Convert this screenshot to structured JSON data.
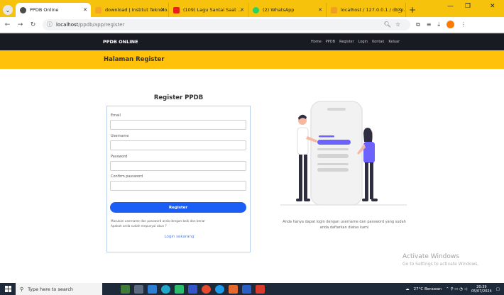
{
  "browser": {
    "tabs": [
      {
        "title": "PPDB Online",
        "favicon_color": "#4a4a4a",
        "active": true
      },
      {
        "title": "download | Institut Teknolo…",
        "favicon_color": "#f5a623",
        "active": false
      },
      {
        "title": "(109) Lagu Santai Saat …",
        "favicon_color": "#e62117",
        "active": false
      },
      {
        "title": "(2) WhatsApp",
        "favicon_color": "#25d366",
        "active": false
      },
      {
        "title": "localhost / 127.0.0.1 / db_p…",
        "favicon_color": "#f0a020",
        "active": false
      }
    ],
    "url_host": "localhost",
    "url_path": "/ppdb/app/register"
  },
  "site": {
    "brand": "PPDB ONLINE",
    "menu": [
      "Home",
      "PPDB",
      "Register",
      "Login",
      "Kontak",
      "Keluar"
    ],
    "page_title": "Halaman Register"
  },
  "form": {
    "heading": "Register PPDB",
    "email_label": "Email",
    "username_label": "Username",
    "password_label": "Password",
    "confirm_label": "Confirm password",
    "email_value": "",
    "username_value": "",
    "password_value": "",
    "confirm_value": "",
    "submit_label": "Register",
    "note_line1": "Masukan username dan password anda dengan baik dan benar",
    "note_line2": "Apakah anda sudah mepunyai akun ?",
    "login_link": "Login sekarang"
  },
  "info": {
    "line1": "Anda hanya dapat login dengan username dan password yang sudah",
    "line2": "anda daftarkan diatas kami"
  },
  "watermark": {
    "title": "Activate Windows",
    "subtitle": "Go to Settings to activate Windows."
  },
  "taskbar": {
    "search_placeholder": "Type here to search",
    "weather": "27°C  Berawan",
    "time": "20:39",
    "date": "05/07/2024"
  },
  "colors": {
    "accent_yellow": "#ffc10a",
    "nav_dark": "#191b23",
    "button_blue": "#1b5ef5",
    "illustration_purple": "#6c63ff"
  }
}
